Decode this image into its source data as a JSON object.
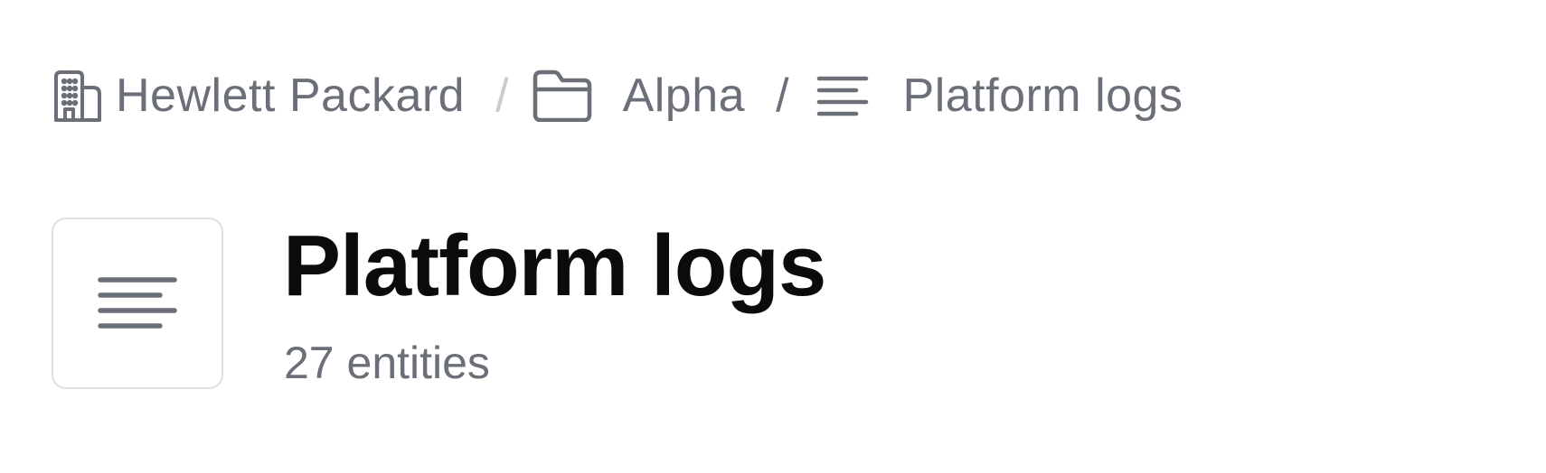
{
  "breadcrumb": {
    "items": [
      {
        "label": "Hewlett Packard",
        "icon": "building-icon"
      },
      {
        "label": "Alpha",
        "icon": "folder-icon"
      },
      {
        "label": "Platform logs",
        "icon": "text-lines-icon"
      }
    ],
    "separator": "/"
  },
  "header": {
    "tile_icon": "text-lines-icon",
    "title": "Platform logs",
    "subtitle": "27 entities"
  },
  "colors": {
    "muted_text": "#6b6f78",
    "title_text": "#0b0b0c",
    "light_separator": "#c9cbd0",
    "tile_border": "#e4dde0"
  }
}
